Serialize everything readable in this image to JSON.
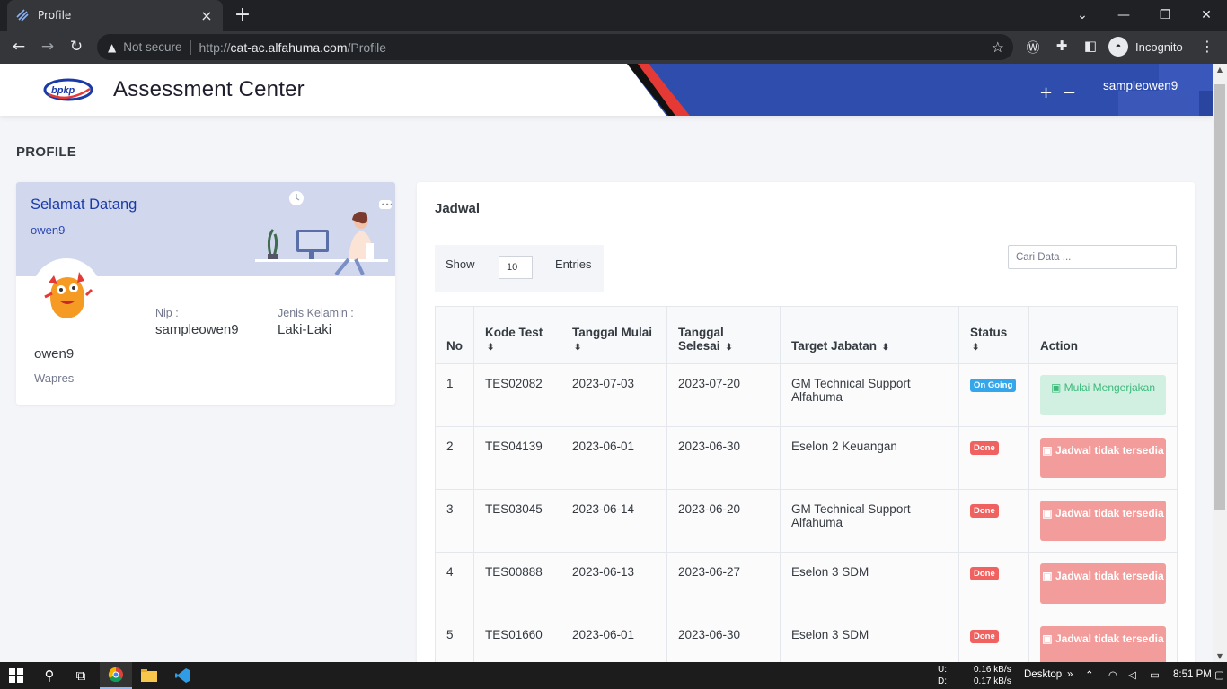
{
  "browser": {
    "tab_title": "Profile",
    "not_secure": "Not secure",
    "url_scheme": "http://",
    "url_host": "cat-ac.alfahuma.com",
    "url_path": "/Profile",
    "profile_label": "Incognito"
  },
  "header": {
    "app_title": "Assessment Center",
    "logo_text": "bpkp",
    "username": "sampleowen9",
    "plus": "+",
    "minus": "−"
  },
  "page": {
    "heading": "PROFILE"
  },
  "profile": {
    "welcome": "Selamat Datang",
    "welcome_user": "owen9",
    "nip_label": "Nip :",
    "nip_value": "sampleowen9",
    "gender_label": "Jenis Kelamin :",
    "gender_value": "Laki-Laki",
    "name": "owen9",
    "role": "Wapres"
  },
  "jadwal": {
    "title": "Jadwal",
    "show_label": "Show",
    "page_size": "10",
    "entries_label": "Entries",
    "search_placeholder": "Cari Data ...",
    "columns": [
      "No",
      "Kode Test",
      "Tanggal Mulai",
      "Tanggal Selesai",
      "Target Jabatan",
      "Status",
      "Action"
    ],
    "rows": [
      {
        "no": "1",
        "kode": "TES02082",
        "mulai": "2023-07-03",
        "selesai": "2023-07-20",
        "target": "GM Technical Support Alfahuma",
        "status": "On Going",
        "action": "Mulai Mengerjakan"
      },
      {
        "no": "2",
        "kode": "TES04139",
        "mulai": "2023-06-01",
        "selesai": "2023-06-30",
        "target": "Eselon 2 Keuangan",
        "status": "Done",
        "action": "Jadwal tidak tersedia"
      },
      {
        "no": "3",
        "kode": "TES03045",
        "mulai": "2023-06-14",
        "selesai": "2023-06-20",
        "target": "GM Technical Support Alfahuma",
        "status": "Done",
        "action": "Jadwal tidak tersedia"
      },
      {
        "no": "4",
        "kode": "TES00888",
        "mulai": "2023-06-13",
        "selesai": "2023-06-27",
        "target": "Eselon 3 SDM",
        "status": "Done",
        "action": "Jadwal tidak tersedia"
      },
      {
        "no": "5",
        "kode": "TES01660",
        "mulai": "2023-06-01",
        "selesai": "2023-06-30",
        "target": "Eselon 3 SDM",
        "status": "Done",
        "action": "Jadwal tidak tersedia"
      }
    ]
  },
  "taskbar": {
    "net_up_label": "U:",
    "net_down_label": "D:",
    "net_up": "0.16 kB/s",
    "net_down": "0.17 kB/s",
    "desktop": "Desktop",
    "time": "8:51 PM"
  },
  "colors": {
    "brand_blue": "#2f4dad",
    "accent_red": "#e53935",
    "badge_going": "#34a7ec",
    "badge_done": "#f0625f"
  }
}
